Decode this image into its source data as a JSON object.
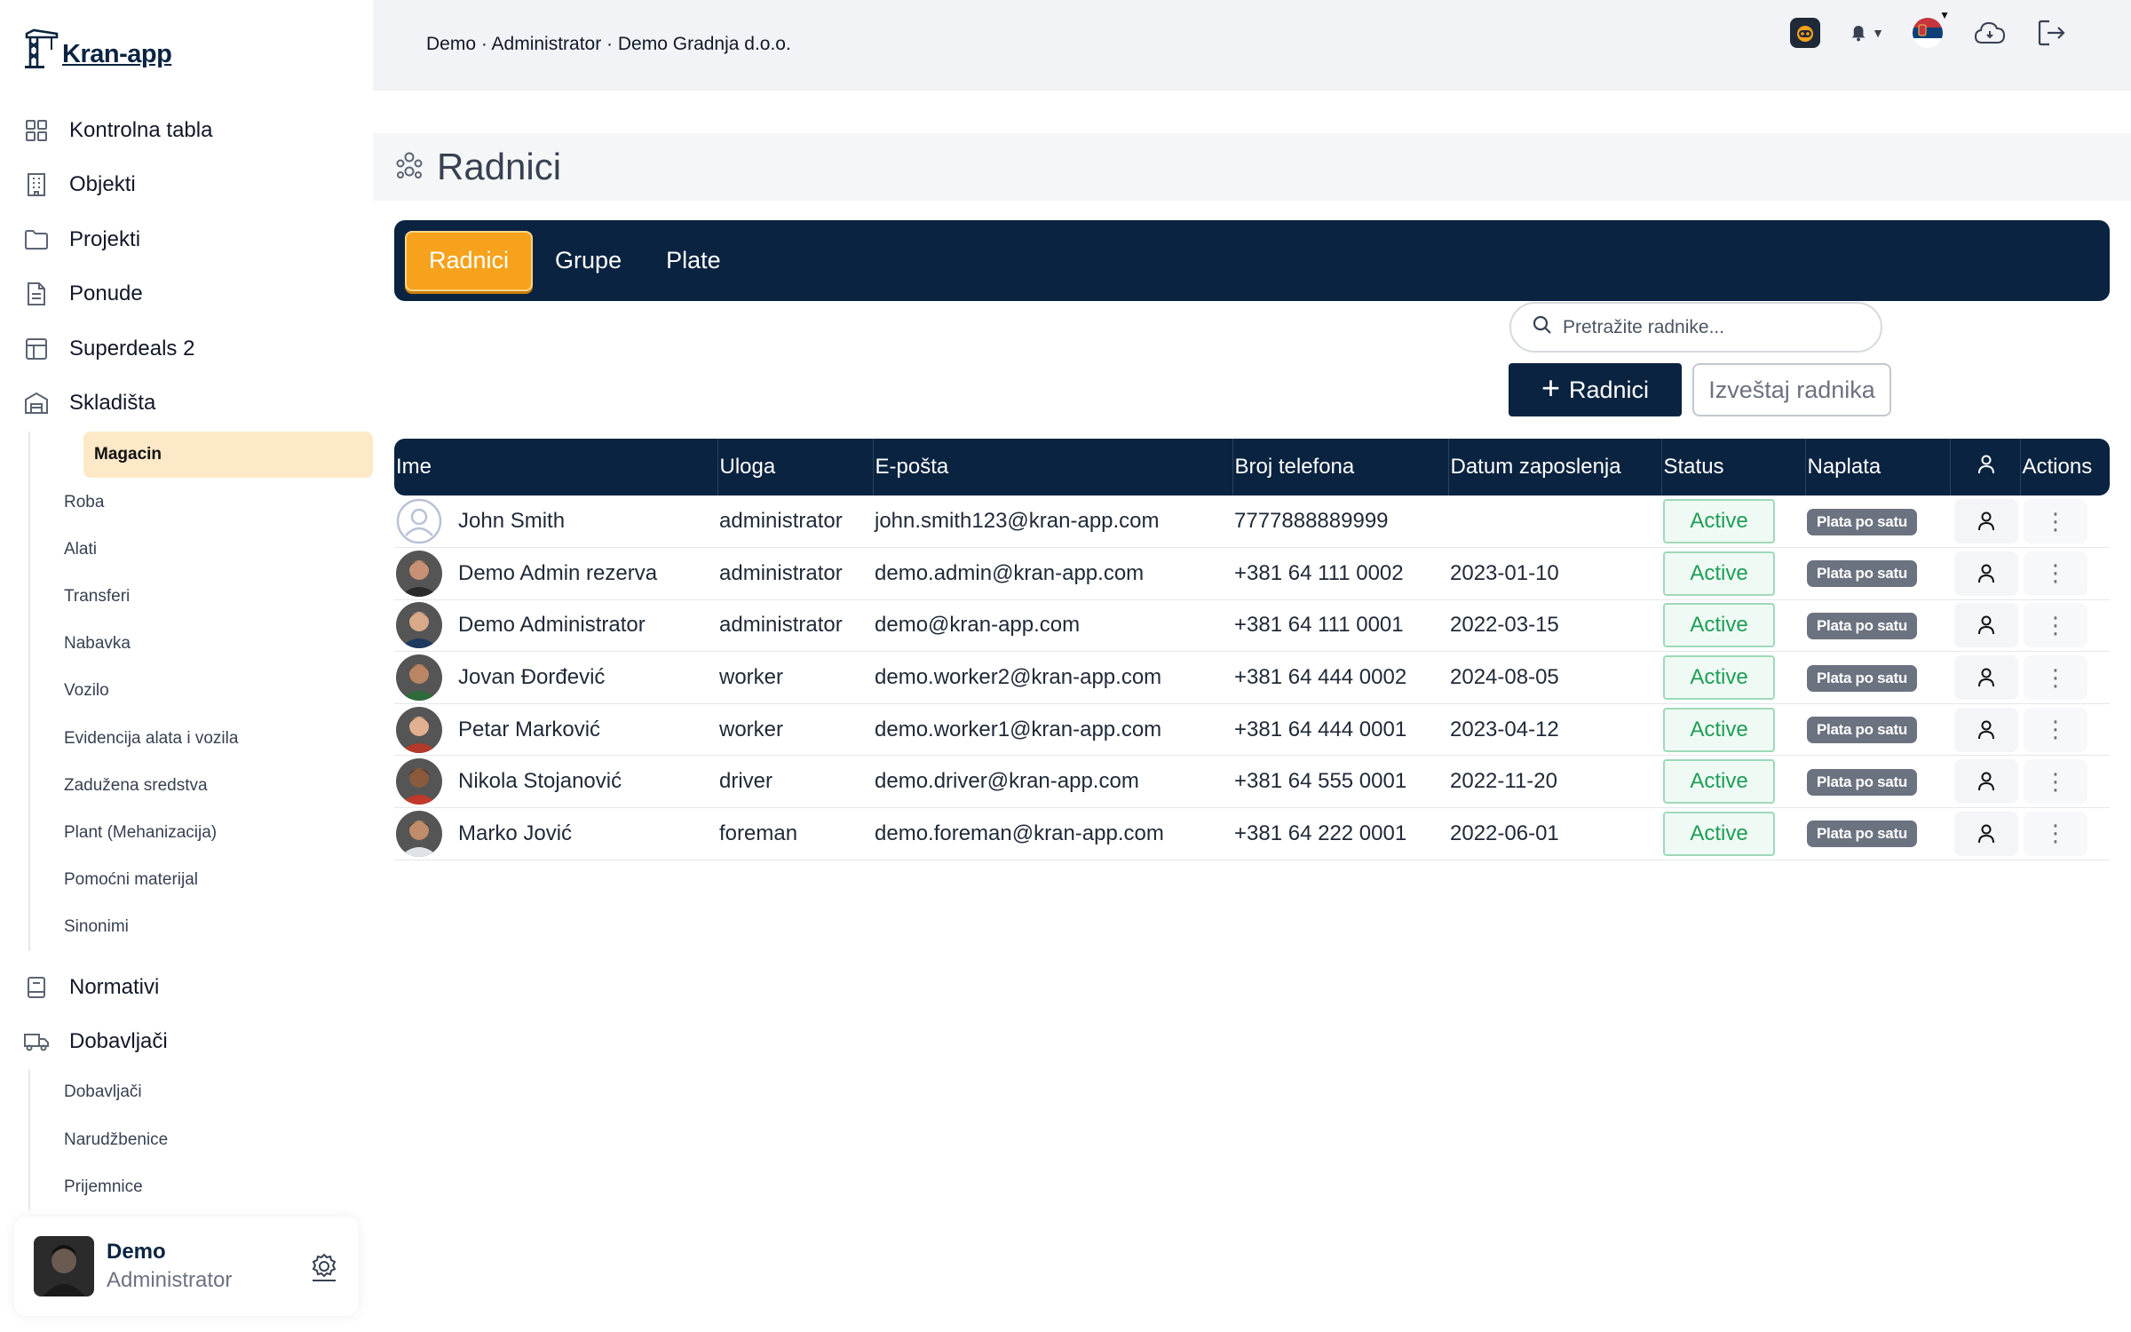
{
  "app": {
    "logo_text": "Kran-app"
  },
  "topbar": {
    "breadcrumb": "Demo · Administrator · Demo Gradnja d.o.o.",
    "icons": [
      "ai-icon",
      "bell-icon",
      "serbia-flag-icon",
      "cloud-icon",
      "logout-icon"
    ]
  },
  "sidebar": {
    "items": [
      {
        "label": "Kontrolna tabla",
        "icon": "grid-icon"
      },
      {
        "label": "Objekti",
        "icon": "building-icon"
      },
      {
        "label": "Projekti",
        "icon": "folder-icon"
      },
      {
        "label": "Ponude",
        "icon": "document-icon"
      },
      {
        "label": "Superdeals 2",
        "icon": "table-icon"
      },
      {
        "label": "Skladišta",
        "icon": "warehouse-icon"
      }
    ],
    "warehouse_sub": [
      "Magacin",
      "Roba",
      "Alati",
      "Transferi",
      "Nabavka",
      "Vozilo",
      "Evidencija alata i vozila",
      "Zadužena sredstva",
      "Plant (Mehanizacija)",
      "Pomoćni materijal",
      "Sinonimi"
    ],
    "items2": [
      {
        "label": "Normativi",
        "icon": "book-icon"
      },
      {
        "label": "Dobavljači",
        "icon": "truck-icon"
      }
    ],
    "supplier_sub": [
      "Dobavljači",
      "Narudžbenice",
      "Prijemnice"
    ],
    "user": {
      "name": "Demo",
      "role": "Administrator"
    }
  },
  "page": {
    "title": "Radnici",
    "tabs": [
      "Radnici",
      "Grupe",
      "Plate"
    ],
    "active_tab": "Radnici",
    "search_placeholder": "Pretražite radnike...",
    "add_button": "Radnici",
    "report_button": "Izveštaj radnika"
  },
  "table": {
    "columns": [
      "Ime",
      "Uloga",
      "E-pošta",
      "Broj telefona",
      "Datum zaposlenja",
      "Status",
      "Naplata",
      "",
      "Actions"
    ],
    "rows": [
      {
        "name": "John Smith",
        "role": "administrator",
        "email": "john.smith123@kran-app.com",
        "phone": "7777888889999",
        "date": "",
        "status": "Active",
        "billing": "Plata po satu"
      },
      {
        "name": "Demo Admin rezerva",
        "role": "administrator",
        "email": "demo.admin@kran-app.com",
        "phone": "+381 64 111 0002",
        "date": "2023-01-10",
        "status": "Active",
        "billing": "Plata po satu"
      },
      {
        "name": "Demo Administrator",
        "role": "administrator",
        "email": "demo@kran-app.com",
        "phone": "+381 64 111 0001",
        "date": "2022-03-15",
        "status": "Active",
        "billing": "Plata po satu"
      },
      {
        "name": "Jovan Đorđević",
        "role": "worker",
        "email": "demo.worker2@kran-app.com",
        "phone": "+381 64 444 0002",
        "date": "2024-08-05",
        "status": "Active",
        "billing": "Plata po satu"
      },
      {
        "name": "Petar Marković",
        "role": "worker",
        "email": "demo.worker1@kran-app.com",
        "phone": "+381 64 444 0001",
        "date": "2023-04-12",
        "status": "Active",
        "billing": "Plata po satu"
      },
      {
        "name": "Nikola Stojanović",
        "role": "driver",
        "email": "demo.driver@kran-app.com",
        "phone": "+381 64 555 0001",
        "date": "2022-11-20",
        "status": "Active",
        "billing": "Plata po satu"
      },
      {
        "name": "Marko Jović",
        "role": "foreman",
        "email": "demo.foreman@kran-app.com",
        "phone": "+381 64 222 0001",
        "date": "2022-06-01",
        "status": "Active",
        "billing": "Plata po satu"
      }
    ]
  },
  "colors": {
    "navy": "#0a2340",
    "orange": "#f6a21c",
    "active_green": "#1f9d57",
    "magacin_bg": "#fde9c7"
  }
}
